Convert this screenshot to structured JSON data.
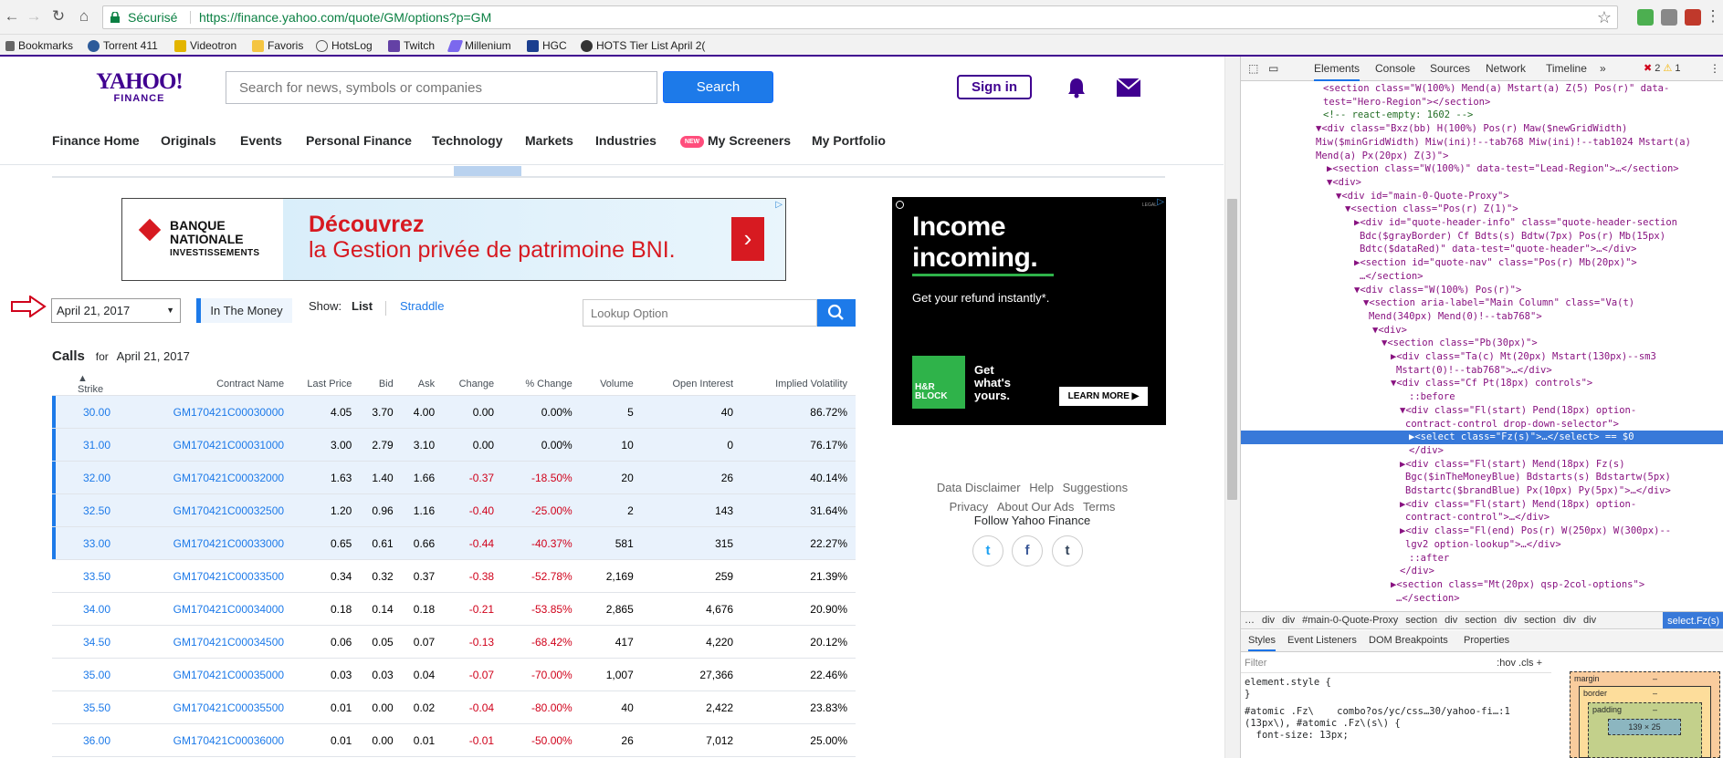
{
  "browser": {
    "secure_label": "Sécurisé",
    "url": "https://finance.yahoo.com/quote/GM/options?p=GM",
    "bookmarks": [
      "Bookmarks",
      "Torrent 411",
      "Videotron",
      "Favoris",
      "HotsLog",
      "Twitch",
      "Millenium",
      "HGC",
      "HOTS Tier List April 2("
    ]
  },
  "header": {
    "logo_text": "YAHOO!",
    "logo_sub": "FINANCE",
    "search_placeholder": "Search for news, symbols or companies",
    "search_button": "Search",
    "signin": "Sign in"
  },
  "nav": {
    "items": [
      "Finance Home",
      "Originals",
      "Events",
      "Personal Finance",
      "Technology",
      "Markets",
      "Industries",
      "My Screeners",
      "My Portfolio"
    ],
    "new_badge": "NEW"
  },
  "banner": {
    "brand_name": "BANQUE NATIONALE",
    "brand_sub": "INVESTISSEMENTS",
    "headline": "Découvrez",
    "subline": "la Gestion privée de patrimoine BNI."
  },
  "controls": {
    "date": "April 21, 2017",
    "in_the_money": "In The Money",
    "show_label": "Show:",
    "list": "List",
    "straddle": "Straddle",
    "lookup_placeholder": "Lookup Option"
  },
  "calls": {
    "title": "Calls",
    "for": "for",
    "date": "April 21, 2017",
    "columns": [
      "Strike",
      "Contract Name",
      "Last Price",
      "Bid",
      "Ask",
      "Change",
      "% Change",
      "Volume",
      "Open Interest",
      "Implied Volatility"
    ],
    "rows": [
      {
        "itm": true,
        "strike": "30.00",
        "contract": "GM170421C00030000",
        "last": "4.05",
        "bid": "3.70",
        "ask": "4.00",
        "change": "0.00",
        "pct": "0.00%",
        "volume": "5",
        "oi": "40",
        "iv": "86.72%"
      },
      {
        "itm": true,
        "strike": "31.00",
        "contract": "GM170421C00031000",
        "last": "3.00",
        "bid": "2.79",
        "ask": "3.10",
        "change": "0.00",
        "pct": "0.00%",
        "volume": "10",
        "oi": "0",
        "iv": "76.17%"
      },
      {
        "itm": true,
        "strike": "32.00",
        "contract": "GM170421C00032000",
        "last": "1.63",
        "bid": "1.40",
        "ask": "1.66",
        "change": "-0.37",
        "pct": "-18.50%",
        "volume": "20",
        "oi": "26",
        "iv": "40.14%"
      },
      {
        "itm": true,
        "strike": "32.50",
        "contract": "GM170421C00032500",
        "last": "1.20",
        "bid": "0.96",
        "ask": "1.16",
        "change": "-0.40",
        "pct": "-25.00%",
        "volume": "2",
        "oi": "143",
        "iv": "31.64%"
      },
      {
        "itm": true,
        "strike": "33.00",
        "contract": "GM170421C00033000",
        "last": "0.65",
        "bid": "0.61",
        "ask": "0.66",
        "change": "-0.44",
        "pct": "-40.37%",
        "volume": "581",
        "oi": "315",
        "iv": "22.27%"
      },
      {
        "itm": false,
        "strike": "33.50",
        "contract": "GM170421C00033500",
        "last": "0.34",
        "bid": "0.32",
        "ask": "0.37",
        "change": "-0.38",
        "pct": "-52.78%",
        "volume": "2,169",
        "oi": "259",
        "iv": "21.39%"
      },
      {
        "itm": false,
        "strike": "34.00",
        "contract": "GM170421C00034000",
        "last": "0.18",
        "bid": "0.14",
        "ask": "0.18",
        "change": "-0.21",
        "pct": "-53.85%",
        "volume": "2,865",
        "oi": "4,676",
        "iv": "20.90%"
      },
      {
        "itm": false,
        "strike": "34.50",
        "contract": "GM170421C00034500",
        "last": "0.06",
        "bid": "0.05",
        "ask": "0.07",
        "change": "-0.13",
        "pct": "-68.42%",
        "volume": "417",
        "oi": "4,220",
        "iv": "20.12%"
      },
      {
        "itm": false,
        "strike": "35.00",
        "contract": "GM170421C00035000",
        "last": "0.03",
        "bid": "0.03",
        "ask": "0.04",
        "change": "-0.07",
        "pct": "-70.00%",
        "volume": "1,007",
        "oi": "27,366",
        "iv": "22.46%"
      },
      {
        "itm": false,
        "strike": "35.50",
        "contract": "GM170421C00035500",
        "last": "0.01",
        "bid": "0.00",
        "ask": "0.02",
        "change": "-0.04",
        "pct": "-80.00%",
        "volume": "40",
        "oi": "2,422",
        "iv": "23.83%"
      },
      {
        "itm": false,
        "strike": "36.00",
        "contract": "GM170421C00036000",
        "last": "0.01",
        "bid": "0.00",
        "ask": "0.01",
        "change": "-0.01",
        "pct": "-50.00%",
        "volume": "26",
        "oi": "7,012",
        "iv": "25.00%"
      }
    ]
  },
  "side_ad": {
    "line1": "Income",
    "line2": "incoming.",
    "tagline": "Get your refund instantly*.",
    "brand": "H&R BLOCK",
    "get": "Get what's yours.",
    "cta": "LEARN MORE",
    "small": "LEGAL"
  },
  "footer": {
    "links": [
      "Data Disclaimer",
      "Help",
      "Suggestions",
      "Privacy",
      "About Our Ads",
      "Terms"
    ],
    "follow": "Follow Yahoo Finance",
    "social": [
      "t",
      "f",
      "t"
    ]
  },
  "devtools": {
    "tabs": [
      "Elements",
      "Console",
      "Sources",
      "Network",
      "Timeline"
    ],
    "errors": "2",
    "warnings": "1",
    "tree": [
      {
        "text": "<section class=\"W(100%) Mend(a) Mstart(a) Z(5) Pos(r)\" data-",
        "indent": 90
      },
      {
        "text": "test=\"Hero-Region\"></section>",
        "indent": 90
      },
      {
        "text": "<!-- react-empty: 1602 -->",
        "indent": 90,
        "comment": true
      },
      {
        "text": "▼<div class=\"Bxz(bb) H(100%) Pos(r) Maw($newGridWidth)",
        "indent": 82
      },
      {
        "text": "Miw($minGridWidth) Miw(ini)!--tab768 Miw(ini)!--tab1024 Mstart(a)",
        "indent": 82
      },
      {
        "text": "Mend(a) Px(20px) Z(3)\">",
        "indent": 82
      },
      {
        "text": "▶<section class=\"W(100%)\" data-test=\"Lead-Region\">…</section>",
        "indent": 94
      },
      {
        "text": "▼<div>",
        "indent": 94
      },
      {
        "text": "▼<div id=\"main-0-Quote-Proxy\">",
        "indent": 104
      },
      {
        "text": "▼<section class=\"Pos(r) Z(1)\">",
        "indent": 114
      },
      {
        "text": "▶<div id=\"quote-header-info\" class=\"quote-header-section",
        "indent": 124
      },
      {
        "text": "Bdc($grayBorder) Cf Bdts(s) Bdtw(7px) Pos(r) Mb(15px)",
        "indent": 130
      },
      {
        "text": "Bdtc($dataRed)\" data-test=\"quote-header\">…</div>",
        "indent": 130
      },
      {
        "text": "▶<section id=\"quote-nav\" class=\"Pos(r) Mb(20px)\">",
        "indent": 124
      },
      {
        "text": "…</section>",
        "indent": 130
      },
      {
        "text": "▼<div class=\"W(100%) Pos(r)\">",
        "indent": 124
      },
      {
        "text": "▼<section aria-label=\"Main Column\" class=\"Va(t)",
        "indent": 134
      },
      {
        "text": "Mend(340px) Mend(0)!--tab768\">",
        "indent": 140
      },
      {
        "text": "▼<div>",
        "indent": 144
      },
      {
        "text": "▼<section class=\"Pb(30px)\">",
        "indent": 154
      },
      {
        "text": "▶<div class=\"Ta(c) Mt(20px) Mstart(130px)--sm3",
        "indent": 164
      },
      {
        "text": "Mstart(0)!--tab768\">…</div>",
        "indent": 170
      },
      {
        "text": "▼<div class=\"Cf Pt(18px) controls\">",
        "indent": 164
      },
      {
        "text": "::before",
        "indent": 184
      },
      {
        "text": "▼<div class=\"Fl(start) Pend(18px) option-",
        "indent": 174
      },
      {
        "text": "contract-control drop-down-selector\">",
        "indent": 180
      },
      {
        "text": "▶<select class=\"Fz(s)\">…</select> == $0",
        "indent": 184,
        "selected": true
      },
      {
        "text": "</div>",
        "indent": 184
      },
      {
        "text": "▶<div class=\"Fl(start) Mend(18px) Fz(s)",
        "indent": 174
      },
      {
        "text": "Bgc($inTheMoneyBlue) Bdstarts(s) Bdstartw(5px)",
        "indent": 180
      },
      {
        "text": "Bdstartc($brandBlue) Px(10px) Py(5px)\">…</div>",
        "indent": 180
      },
      {
        "text": "▶<div class=\"Fl(start) Mend(18px) option-",
        "indent": 174
      },
      {
        "text": "contract-control\">…</div>",
        "indent": 180
      },
      {
        "text": "▶<div class=\"Fl(end) Pos(r) W(250px) W(300px)--",
        "indent": 174
      },
      {
        "text": "lgv2 option-lookup\">…</div>",
        "indent": 180
      },
      {
        "text": "::after",
        "indent": 184
      },
      {
        "text": "</div>",
        "indent": 174
      },
      {
        "text": "▶<section class=\"Mt(20px) qsp-2col-options\">",
        "indent": 164
      },
      {
        "text": "…</section>",
        "indent": 170
      }
    ],
    "crumbs": [
      "…",
      "div",
      "div",
      "#main-0-Quote-Proxy",
      "section",
      "div",
      "section",
      "div",
      "section",
      "div",
      "div"
    ],
    "crumb_selected": "select.Fz(s)",
    "subtabs": [
      "Styles",
      "Event Listeners",
      "DOM Breakpoints",
      "Properties"
    ],
    "filter": "Filter",
    "hov": ":hov  .cls  +",
    "styles": [
      "element.style {",
      "}",
      "#atomic .Fz\\    combo?os/yc/css…30/yahoo-fi…:1",
      "(13px\\), #atomic .Fz\\(s\\) {",
      "  font-size: 13px;"
    ],
    "box": {
      "margin": "margin",
      "border": "border",
      "padding": "padding",
      "content": "139 × 25",
      "dash": "–"
    }
  }
}
